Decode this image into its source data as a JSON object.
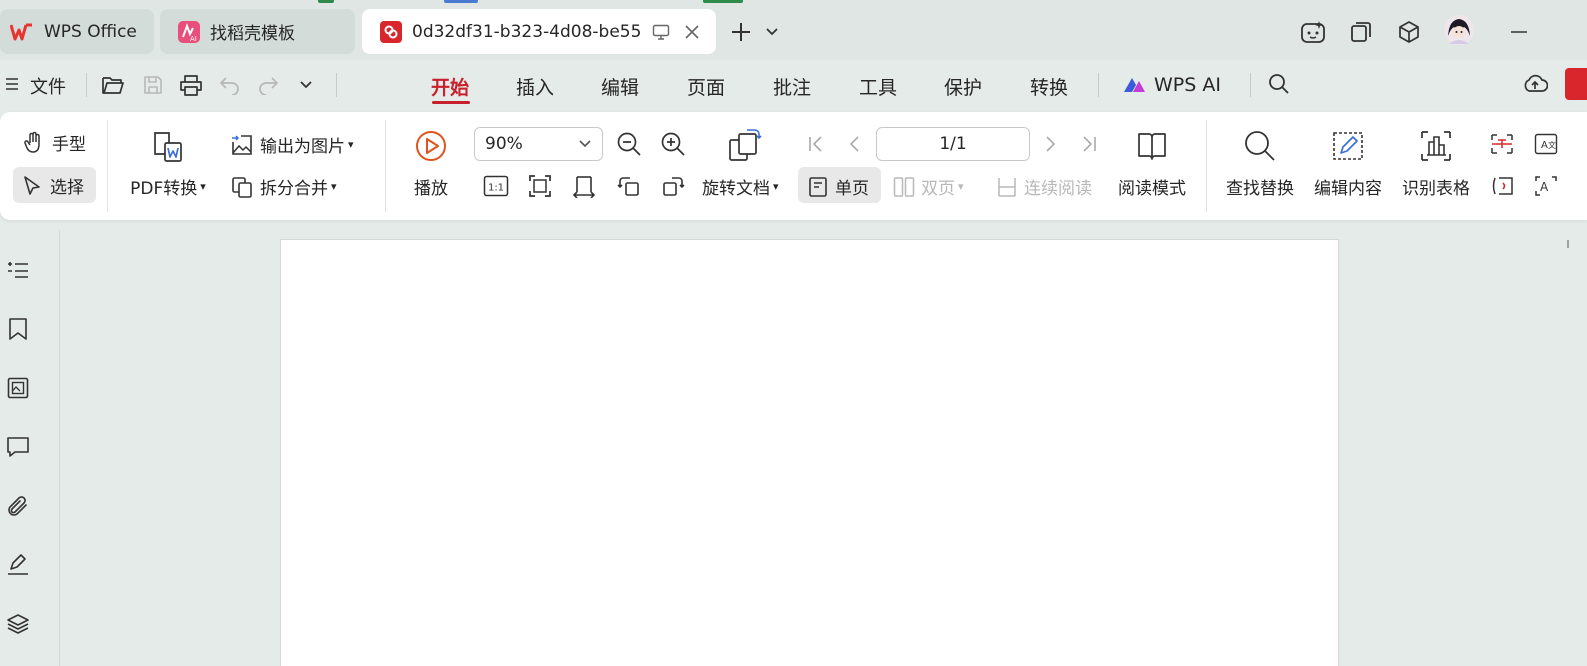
{
  "colors": {
    "accent": "#c8202c",
    "wps_red": "#e8342e",
    "pdf_icon_red": "#d9262c",
    "ai_blue": "#3b5bdb"
  },
  "tabs": [
    {
      "label": "WPS Office",
      "icon": "wps-logo-icon"
    },
    {
      "label": "找稻壳模板",
      "icon": "docer-logo-icon"
    },
    {
      "label": "0d32df31-b323-4d08-be55",
      "icon": "pdf-file-icon",
      "active": true
    }
  ],
  "window": {
    "new_tab": "plus-icon",
    "tab_menu": "chevron-down-icon",
    "minimize": "minimize-icon"
  },
  "menubar": {
    "file": "文件",
    "tabs": [
      "开始",
      "插入",
      "编辑",
      "页面",
      "批注",
      "工具",
      "保护",
      "转换"
    ],
    "active_tab": "开始",
    "wps_ai": "WPS AI"
  },
  "ribbon": {
    "hand": "手型",
    "select": "选择",
    "pdf_convert": "PDF转换",
    "export_image": "输出为图片",
    "split_merge": "拆分合并",
    "play": "播放",
    "zoom_value": "90%",
    "rotate_doc": "旋转文档",
    "page_value": "1/1",
    "single_page": "单页",
    "double_page": "双页",
    "continuous": "连续阅读",
    "read_mode": "阅读模式",
    "find_replace": "查找替换",
    "edit_content": "编辑内容",
    "recognize_table": "识别表格"
  },
  "sidebar": [
    "outline-icon",
    "bookmark-icon",
    "thumbnail-icon",
    "comment-icon",
    "attachment-icon",
    "signature-icon",
    "layers-icon"
  ]
}
